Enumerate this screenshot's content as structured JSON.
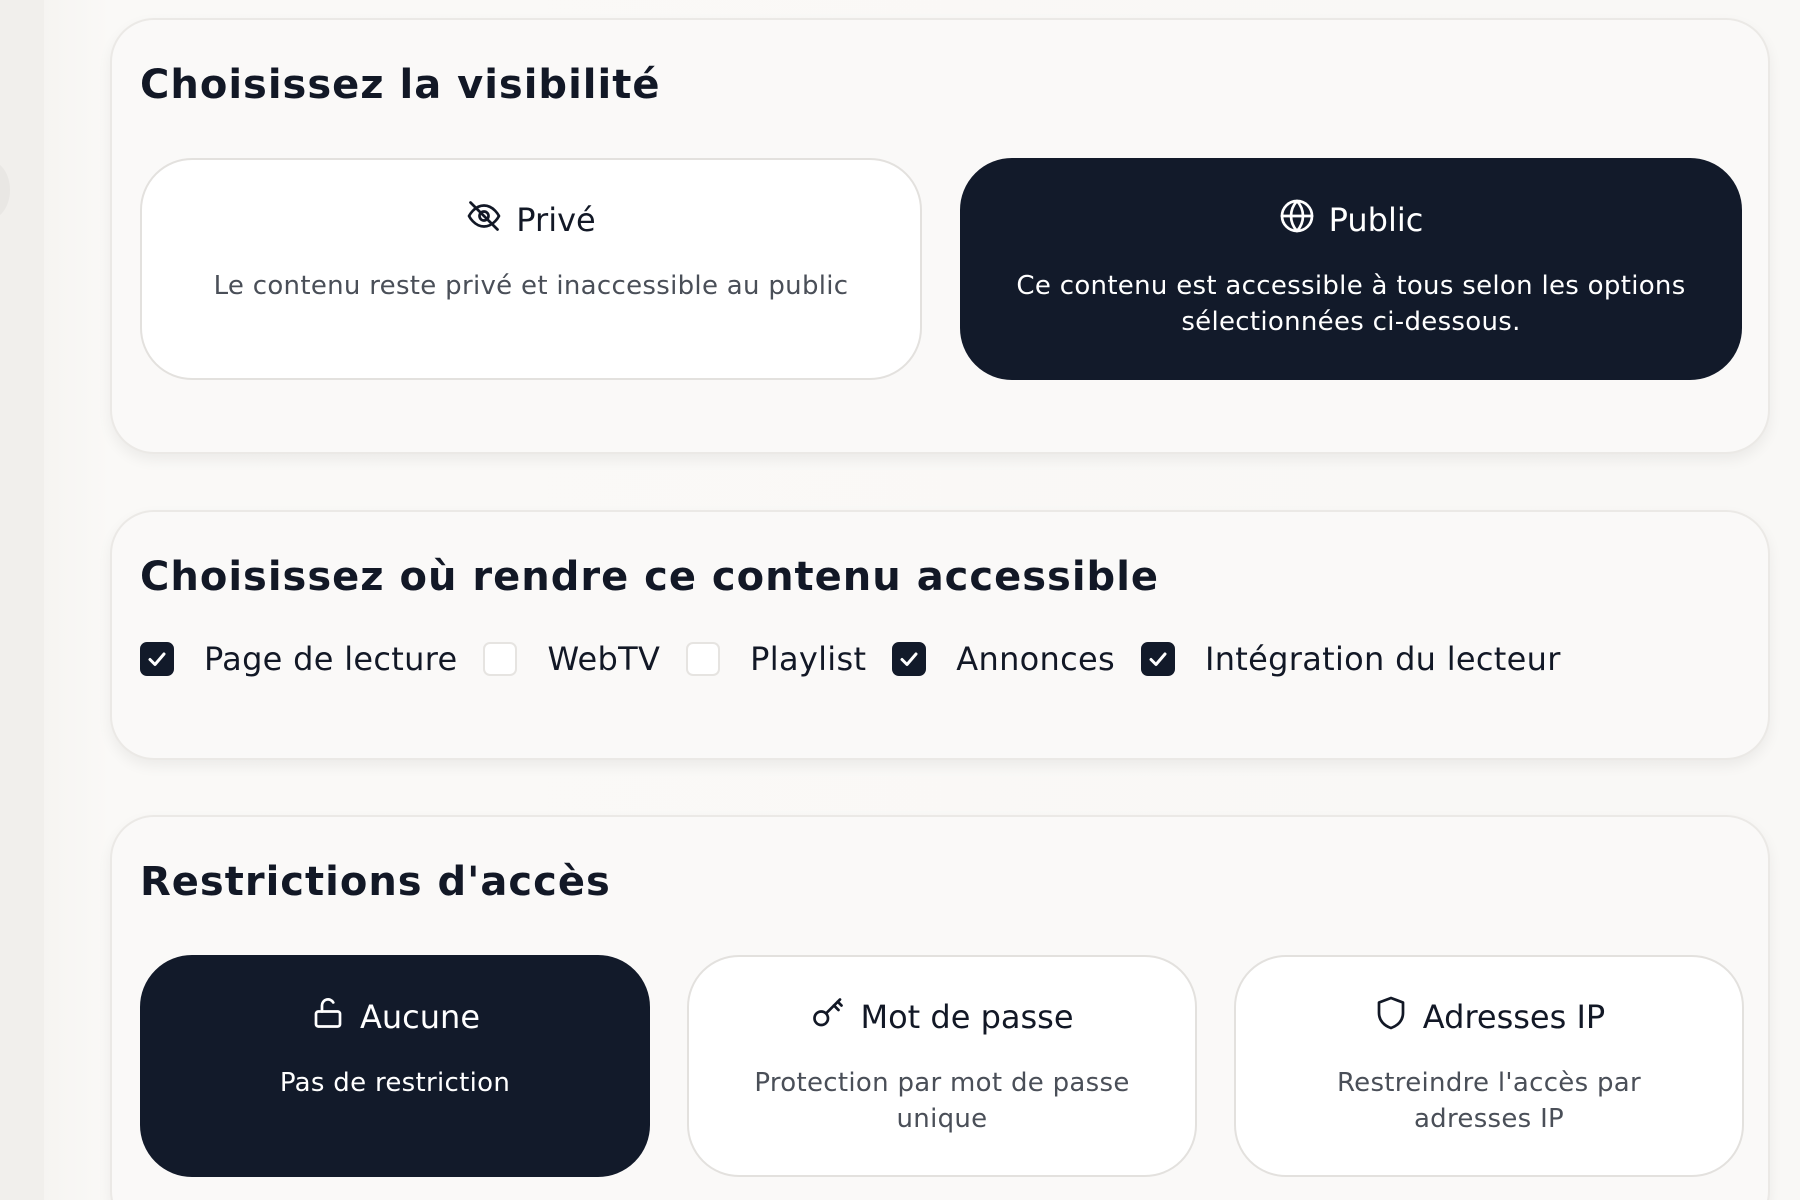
{
  "colors": {
    "selected_bg": "#121a2a",
    "text": "#121826",
    "muted_text": "#4a4f58",
    "card_bg": "#faf9f8",
    "border": "#e3e1de"
  },
  "visibility": {
    "title": "Choisissez la visibilité",
    "options": [
      {
        "icon": "eye-off-icon",
        "label": "Privé",
        "description": "Le contenu reste privé et inaccessible au public",
        "selected": false
      },
      {
        "icon": "globe-icon",
        "label": "Public",
        "description": "Ce contenu est accessible à tous selon les options sélectionnées ci-dessous.",
        "selected": true
      }
    ]
  },
  "accessibility": {
    "title": "Choisissez où rendre ce contenu accessible",
    "items": [
      {
        "label": "Page de lecture",
        "checked": true
      },
      {
        "label": "WebTV",
        "checked": false
      },
      {
        "label": "Playlist",
        "checked": false
      },
      {
        "label": "Annonces",
        "checked": true
      },
      {
        "label": "Intégration du lecteur",
        "checked": true
      }
    ]
  },
  "restrictions": {
    "title": "Restrictions d'accès",
    "options": [
      {
        "icon": "unlock-icon",
        "label": "Aucune",
        "description": "Pas de restriction",
        "selected": true
      },
      {
        "icon": "key-icon",
        "label": "Mot de passe",
        "description": "Protection par mot de passe unique",
        "selected": false
      },
      {
        "icon": "shield-icon",
        "label": "Adresses IP",
        "description": "Restreindre l'accès par adresses IP",
        "selected": false
      }
    ]
  }
}
